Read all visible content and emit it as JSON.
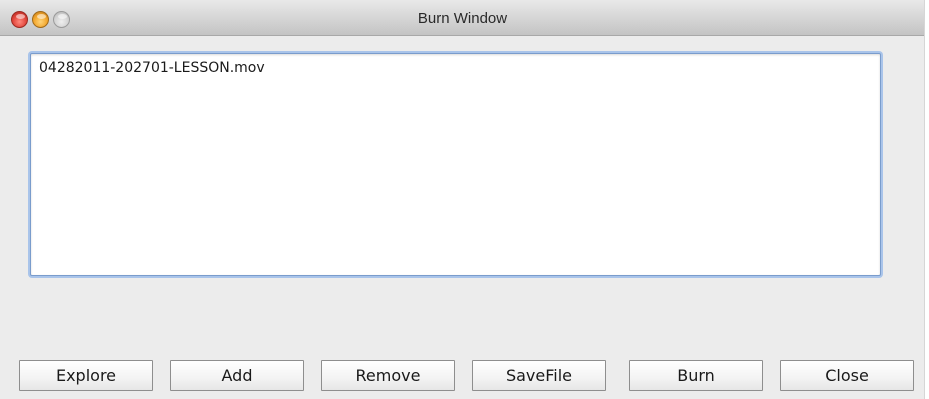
{
  "window": {
    "title": "Burn Window",
    "controls": [
      "close",
      "minimize",
      "zoom"
    ]
  },
  "file_list": {
    "items": [
      "04282011-202701-LESSON.mov"
    ]
  },
  "buttons": {
    "explore": "Explore",
    "add": "Add",
    "remove": "Remove",
    "savefile": "SaveFile",
    "burn": "Burn",
    "close": "Close"
  },
  "colors": {
    "window_bg": "#ececec",
    "focus_ring": "#a9c4ea",
    "close_light": "#e0443a",
    "minimize_light": "#f2a52a"
  }
}
